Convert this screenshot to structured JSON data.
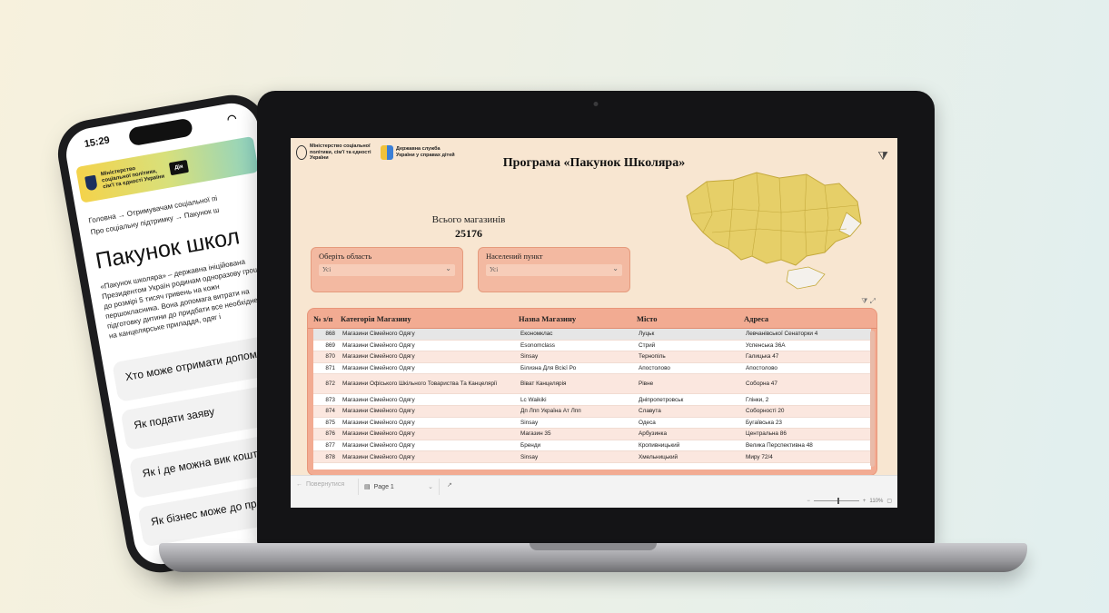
{
  "phone": {
    "time": "15:29",
    "gov_text": "Міністерство соціальної політики, сім'ї та єдності України",
    "dia": "Дія",
    "breadcrumb_1": "Головна → Отримувачам соціальної пі",
    "breadcrumb_2": "Про соціальну підтримку → Пакунок ш",
    "title": "Пакунок школ",
    "body": "«Пакунок школяра» – державна ініційована Президентом Україн родинам одноразову грошову до розмірі 5 тисяч гривень на кожн першокласника. Вона допомага витрати на підготовку дитини до придбати все необхідне для на канцелярське приладдя, одяг і",
    "faq": [
      "Хто може отримати допомогу",
      "Як подати заяву",
      "Як і де можна вик кошти",
      "Як бізнес може до програми"
    ]
  },
  "report": {
    "logo_ministry": "Міністерство соціальної політики, сім'ї та єдності України",
    "logo_service": "Державна служба України у справах дітей",
    "title": "Програма «Пакунок Школяра»",
    "total_label": "Всього магазинів",
    "total_value": "25176",
    "filters": [
      {
        "label": "Оберіть область",
        "value": "Усі"
      },
      {
        "label": "Населений пункт",
        "value": "Усі"
      }
    ],
    "table": {
      "headers": [
        "№ з/п",
        "Категорія Магазину",
        "Назва Магазину",
        "Місто",
        "Адреса"
      ],
      "rows": [
        [
          "868",
          "Магазини Сімейного Одягу",
          "Економклас",
          "Луцьк",
          "Левчанівської Сенаторки 4"
        ],
        [
          "869",
          "Магазини Сімейного Одягу",
          "Esonomclass",
          "Стрий",
          "Успенська 36А"
        ],
        [
          "870",
          "Магазини Сімейного Одягу",
          "Sinsay",
          "Тернопіль",
          "Галицька 47"
        ],
        [
          "871",
          "Магазини Сімейного Одягу",
          "Білизна Для Всієї Ро",
          "Апостолово",
          "Апостолово"
        ],
        [
          "872",
          "Магазини Офіського Шкільного Товариства Та Канцелярії",
          "Віват Канцелярія",
          "Рівне",
          "Соборна 47"
        ],
        [
          "873",
          "Магазини Сімейного Одягу",
          "Lc Waikiki",
          "Дніпропетровськ",
          "Глінки, 2"
        ],
        [
          "874",
          "Магазини Сімейного Одягу",
          "Дп Лпп Україна Ат Лпп",
          "Славута",
          "Соборності 20"
        ],
        [
          "875",
          "Магазини Сімейного Одягу",
          "Sinsay",
          "Одеса",
          "Бугаївська 23"
        ],
        [
          "876",
          "Магазини Сімейного Одягу",
          "Магазин 35",
          "Арбузинка",
          "Центральна 86"
        ],
        [
          "877",
          "Магазини Сімейного Одягу",
          "Бренди",
          "Кропивницький",
          "Велика Перспективна 48"
        ],
        [
          "878",
          "Магазини Сімейного Одягу",
          "Sinsay",
          "Хмельницький",
          "Миру 72/4"
        ]
      ]
    },
    "bottom": {
      "back": "Повернутися",
      "page": "Page 1",
      "zoom": "110%"
    }
  }
}
